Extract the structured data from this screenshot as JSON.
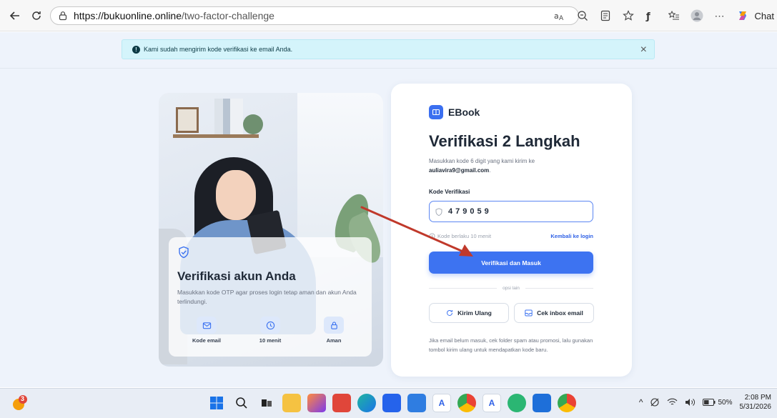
{
  "browser": {
    "url_host": "https://bukuonline.online",
    "url_path": "/two-factor-challenge",
    "chat_label": "Chat",
    "menu_glyph": "⋯"
  },
  "alert": {
    "message": "Kami sudah mengirim kode verifikasi ke email Anda.",
    "info_glyph": "!",
    "close_glyph": "×"
  },
  "left_panel": {
    "title": "Verifikasi akun Anda",
    "description": "Masukkan kode OTP agar proses login tetap aman dan akun Anda terlindungi.",
    "features": [
      {
        "label": "Kode email",
        "icon": "mail-icon"
      },
      {
        "label": "10 menit",
        "icon": "clock-icon"
      },
      {
        "label": "Aman",
        "icon": "lock-icon"
      }
    ]
  },
  "form": {
    "brand": "EBook",
    "heading": "Verifikasi 2 Langkah",
    "subtext_prefix": "Masukkan kode 6 digit yang kami kirim ke",
    "email": "auliavira9@gmail.com",
    "subtext_suffix": ".",
    "field_label": "Kode Verifikasi",
    "otp_value": "479059",
    "validity": "Kode berlaku 10 menit",
    "back_link": "Kembali ke login",
    "submit_label": "Verifikasi dan Masuk",
    "divider_text": "opsi lain",
    "resend_label": "Kirim Ulang",
    "inbox_label": "Cek inbox email",
    "footnote": "Jika email belum masuk, cek folder spam atau promosi, lalu gunakan tombol kirim ulang untuk mendapatkan kode baru."
  },
  "taskbar": {
    "weather_badge": "3",
    "battery": "50%",
    "time": "2:08 PM",
    "date": "5/31/2026",
    "tray_up_glyph": "^"
  },
  "colors": {
    "accent": "#3d73f1",
    "alert_bg": "#d4f4fb",
    "page_bg": "#eef3fb",
    "annotation_arrow": "#c0392b"
  }
}
